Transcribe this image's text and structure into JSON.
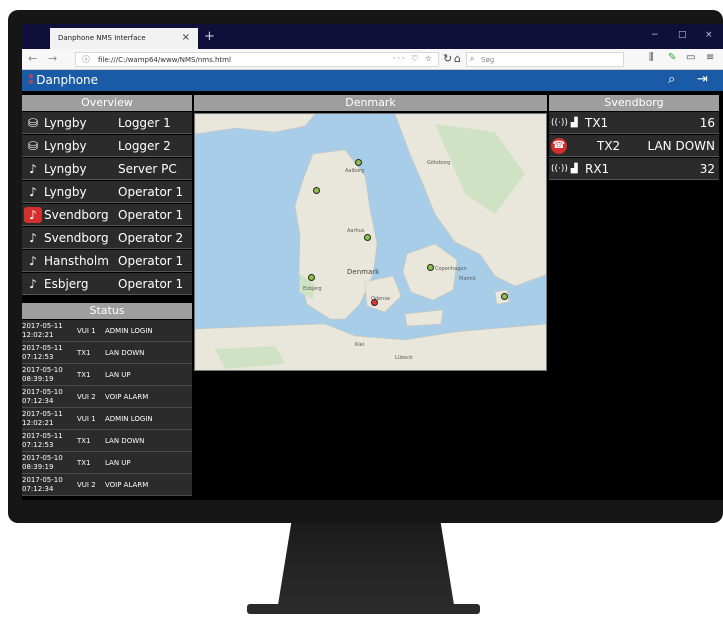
{
  "browser": {
    "tab_title": "Danphone NMS Interface",
    "tab_close": "×",
    "new_tab": "+",
    "url": "file:///C:/wamp64/www/NMS/nms.html",
    "url_icons": "··· ♡ ☆",
    "search_placeholder": "Søg",
    "window_controls": [
      "−",
      "□",
      "×"
    ]
  },
  "app": {
    "brand": "Danphone",
    "brand_mark": "⁑",
    "accent": "#1a5ba8"
  },
  "overview": {
    "title": "Overview",
    "rows": [
      {
        "icon": "database-icon",
        "glyph": "⛁",
        "site": "Lyngby",
        "role": "Logger 1"
      },
      {
        "icon": "database-icon",
        "glyph": "⛁",
        "site": "Lyngby",
        "role": "Logger 2"
      },
      {
        "icon": "headset-icon",
        "glyph": "♪",
        "site": "Lyngby",
        "role": "Server PC"
      },
      {
        "icon": "headset-icon",
        "glyph": "♪",
        "site": "Lyngby",
        "role": "Operator 1"
      },
      {
        "icon": "alarm-headset-icon",
        "glyph": "♪",
        "site": "Svendborg",
        "role": "Operator 1",
        "alarm": true
      },
      {
        "icon": "headset-icon",
        "glyph": "♪",
        "site": "Svendborg",
        "role": "Operator 2"
      },
      {
        "icon": "headset-icon",
        "glyph": "♪",
        "site": "Hanstholm",
        "role": "Operator 1"
      },
      {
        "icon": "headset-icon",
        "glyph": "♪",
        "site": "Esbjerg",
        "role": "Operator 1"
      }
    ]
  },
  "status": {
    "title": "Status",
    "rows": [
      {
        "date": "2017-05-11",
        "time": "12:02:21",
        "device": "VUI 1",
        "event": "ADMIN LOGIN"
      },
      {
        "date": "2017-05-11",
        "time": "07:12:53",
        "device": "TX1",
        "event": "LAN DOWN"
      },
      {
        "date": "2017-05-10",
        "time": "08:39:19",
        "device": "TX1",
        "event": "LAN UP"
      },
      {
        "date": "2017-05-10",
        "time": "07:12:34",
        "device": "VUI 2",
        "event": "VOIP ALARM"
      },
      {
        "date": "2017-05-11",
        "time": "12:02:21",
        "device": "VUI 1",
        "event": "ADMIN LOGIN"
      },
      {
        "date": "2017-05-11",
        "time": "07:12:53",
        "device": "TX1",
        "event": "LAN DOWN"
      },
      {
        "date": "2017-05-10",
        "time": "08:39:19",
        "device": "TX1",
        "event": "LAN UP"
      },
      {
        "date": "2017-05-10",
        "time": "07:12:34",
        "device": "VUI 2",
        "event": "VOIP ALARM"
      }
    ]
  },
  "map": {
    "title": "Denmark",
    "country_label": "Denmark",
    "city_labels": [
      "Aalborg",
      "Aarhus",
      "Odense",
      "Esbjerg",
      "Copenhagen",
      "Malmö",
      "Göteborg",
      "Kiel",
      "Lübeck"
    ],
    "markers": [
      {
        "name": "north",
        "status": "ok",
        "color": "#8bc34a"
      },
      {
        "name": "northwest",
        "status": "ok",
        "color": "#8bc34a"
      },
      {
        "name": "aarhus",
        "status": "ok",
        "color": "#8bc34a"
      },
      {
        "name": "esbjerg",
        "status": "ok",
        "color": "#8bc34a"
      },
      {
        "name": "copenhagen",
        "status": "ok",
        "color": "#8bc34a"
      },
      {
        "name": "bornholm",
        "status": "ok",
        "color": "#8bc34a"
      },
      {
        "name": "svendborg",
        "status": "alarm",
        "color": "#e53935"
      }
    ]
  },
  "svendborg": {
    "title": "Svendborg",
    "rows": [
      {
        "icon": "antenna-signal-icon",
        "name": "TX1",
        "value": "16",
        "alarm": false
      },
      {
        "icon": "alarm-antenna-icon",
        "name": "TX2",
        "value": "LAN DOWN",
        "alarm": true
      },
      {
        "icon": "antenna-signal-icon",
        "name": "RX1",
        "value": "32",
        "alarm": false
      }
    ]
  }
}
